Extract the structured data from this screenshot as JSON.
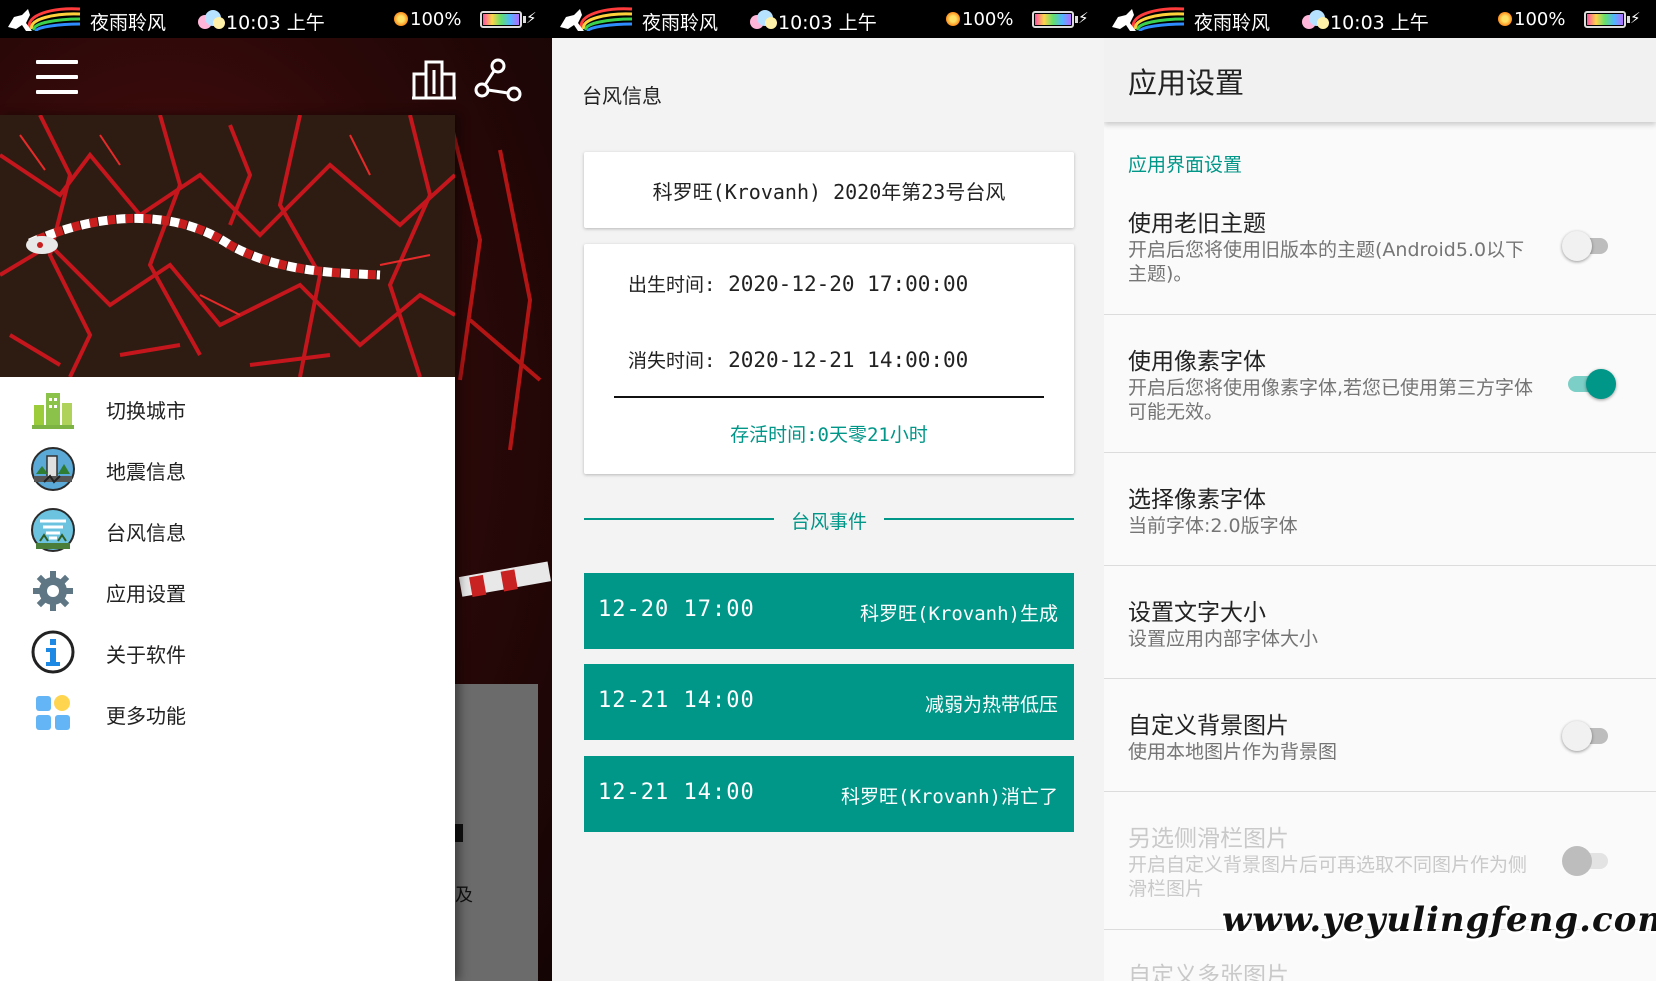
{
  "status_bar": {
    "app_name": "夜雨聆风",
    "time": "10:03 上午",
    "battery": "100%"
  },
  "screen1": {
    "drawer": {
      "items": [
        {
          "label": "切换城市",
          "icon": "city-icon"
        },
        {
          "label": "地震信息",
          "icon": "earthquake-icon"
        },
        {
          "label": "台风信息",
          "icon": "typhoon-icon"
        },
        {
          "label": "应用设置",
          "icon": "gear-icon"
        },
        {
          "label": "关于软件",
          "icon": "info-icon"
        },
        {
          "label": "更多功能",
          "icon": "apps-grid-icon"
        }
      ]
    },
    "toolbar_icons": [
      "menu-icon",
      "building-icon",
      "share-nodes-icon"
    ],
    "behind_text": "及"
  },
  "screen2": {
    "title": "台风信息",
    "typhoon_name": "科罗旺(Krovanh) 2020年第23号台风",
    "birth_label": "出生时间:",
    "birth_time": "2020-12-20 17:00:00",
    "end_label": "消失时间:",
    "end_time": "2020-12-21 14:00:00",
    "alive": "存活时间:0天零21小时",
    "events_title": "台风事件",
    "events": [
      {
        "date": "12-20 17:00",
        "desc": "科罗旺(Krovanh)生成"
      },
      {
        "date": "12-21 14:00",
        "desc": "减弱为热带低压"
      },
      {
        "date": "12-21 14:00",
        "desc": "科罗旺(Krovanh)消亡了"
      }
    ]
  },
  "screen3": {
    "title": "应用设置",
    "section": "应用界面设置",
    "settings": [
      {
        "title": "使用老旧主题",
        "subtitle": "开启后您将使用旧版本的主题(Android5.0以下主题)。",
        "toggle": "off"
      },
      {
        "title": "使用像素字体",
        "subtitle": "开启后您将使用像素字体,若您已使用第三方字体可能无效。",
        "toggle": "on"
      },
      {
        "title": "选择像素字体",
        "subtitle": "当前字体:2.0版字体"
      },
      {
        "title": "设置文字大小",
        "subtitle": "设置应用内部字体大小"
      },
      {
        "title": "自定义背景图片",
        "subtitle": "使用本地图片作为背景图",
        "toggle": "off"
      },
      {
        "title": "另选侧滑栏图片",
        "subtitle": "开启自定义背景图片后可再选取不同图片作为侧滑栏图片",
        "toggle": "off",
        "disabled": true
      },
      {
        "title": "自定义多张图片",
        "disabled": true
      }
    ]
  },
  "watermark": "www.yeyulingfeng.com",
  "colors": {
    "accent": "#009688",
    "status_bar": "#000000",
    "toggle_on_track": "#7ccfc6"
  }
}
